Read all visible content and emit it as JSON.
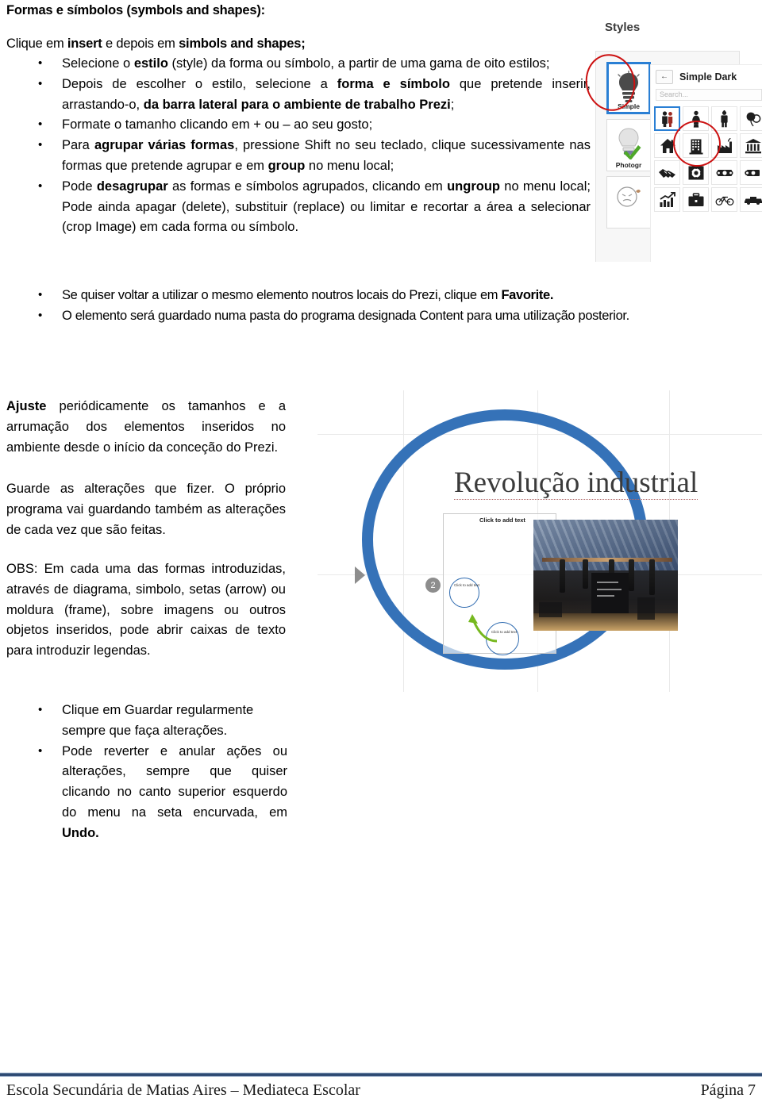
{
  "document": {
    "title": "Formas  e símbolos (symbols and shapes):",
    "lead_prefix": "Clique em ",
    "lead_bold1": "insert",
    "lead_mid": " e depois em ",
    "lead_bold2": "simbols and shapes;"
  },
  "bullets_top": [
    {
      "parts": [
        {
          "t": "Selecione o ",
          "b": false
        },
        {
          "t": "estilo",
          "b": true
        },
        {
          "t": " (style) da forma ou símbolo, a partir de uma gama de oito estilos;",
          "b": false
        }
      ]
    },
    {
      "parts": [
        {
          "t": "Depois de escolher o estilo, selecione a ",
          "b": false
        },
        {
          "t": "forma e símbolo",
          "b": true
        },
        {
          "t": " que pretende inserir, arrastando-o, ",
          "b": false
        },
        {
          "t": "da barra lateral para o ambiente de trabalho Prezi",
          "b": true
        },
        {
          "t": ";",
          "b": false
        }
      ]
    },
    {
      "parts": [
        {
          "t": "Formate o tamanho clicando em + ou – ao seu gosto;",
          "b": false
        }
      ]
    },
    {
      "parts": [
        {
          "t": "Para ",
          "b": false
        },
        {
          "t": "agrupar várias formas",
          "b": true
        },
        {
          "t": ", pressione Shift no seu teclado, clique sucessivamente nas formas que pretende agrupar e em ",
          "b": false
        },
        {
          "t": "group",
          "b": true
        },
        {
          "t": " no menu local;",
          "b": false
        }
      ]
    },
    {
      "parts": [
        {
          "t": "Pode ",
          "b": false
        },
        {
          "t": "desagrupar",
          "b": true
        },
        {
          "t": " as formas e símbolos agrupados, clicando em ",
          "b": false
        },
        {
          "t": "ungroup",
          "b": true
        },
        {
          "t": " no menu local; Pode ainda apagar (delete), substituir (replace) ou limitar e recortar a área a selecionar (crop Image) em cada forma ou símbolo.",
          "b": false
        }
      ]
    }
  ],
  "bullets_wide": [
    {
      "parts": [
        {
          "t": "Se quiser voltar a utilizar o mesmo elemento noutros locais do Prezi, clique em ",
          "b": false
        },
        {
          "t": "Favorite.",
          "b": true
        }
      ]
    },
    {
      "parts": [
        {
          "t": "O elemento será guardado numa pasta do programa designada Content para uma utilização posterior.",
          "b": false
        }
      ]
    }
  ],
  "paragraphs": {
    "ajuste_bold": "Ajuste",
    "ajuste_rest": " periódicamente os tamanhos e a arrumação dos elementos inseridos no ambiente desde o início da conceção do Prezi.",
    "guarde": "Guarde as alterações que fizer. O próprio programa vai guardando também as alterações de cada vez que são feitas.",
    "obs": "OBS: Em cada uma das formas introduzidas, através de diagrama, simbolo, setas (arrow) ou moldura (frame), sobre imagens ou outros objetos inseridos, pode abrir caixas de texto para introduzir legendas."
  },
  "bullets_bottom": [
    {
      "parts": [
        {
          "t": "Clique em Guardar regularmente sempre que faça alterações.",
          "b": false
        }
      ]
    },
    {
      "parts": [
        {
          "t": "Pode reverter e anular ações ou alterações, sempre que quiser clicando no canto superior esquerdo do menu na seta encurvada, em ",
          "b": false
        },
        {
          "t": "Undo.",
          "b": true
        }
      ]
    }
  ],
  "styles_shot": {
    "heading": "Styles",
    "cards": [
      {
        "label": "Simple",
        "selected": true
      },
      {
        "label": "Photogr",
        "selected": false
      },
      {
        "label": "",
        "selected": false
      }
    ],
    "subpanel": {
      "back_label": "←",
      "title": "Simple Dark",
      "search_placeholder": "Search...",
      "icons": [
        {
          "name": "person-pair-icon",
          "selected": true
        },
        {
          "name": "woman-icon",
          "selected": false
        },
        {
          "name": "man-icon",
          "selected": false
        },
        {
          "name": "balloons-icon",
          "selected": false
        },
        {
          "name": "house-icon",
          "selected": false
        },
        {
          "name": "office-building-icon",
          "selected": false
        },
        {
          "name": "factory-icon",
          "selected": false
        },
        {
          "name": "bank-icon",
          "selected": false
        },
        {
          "name": "handshake-icon",
          "selected": false
        },
        {
          "name": "safe-icon",
          "selected": false
        },
        {
          "name": "money-stack-icon",
          "selected": false
        },
        {
          "name": "money-roll-icon",
          "selected": false
        },
        {
          "name": "growth-chart-icon",
          "selected": false
        },
        {
          "name": "briefcase-icon",
          "selected": false
        },
        {
          "name": "bicycle-icon",
          "selected": false
        },
        {
          "name": "car-icon",
          "selected": false
        }
      ]
    },
    "annotations": [
      {
        "name": "red-circle-simple-style"
      },
      {
        "name": "red-circle-woman-symbol"
      }
    ],
    "accent_blue": "#2a7fd4",
    "annotation_red": "#cc1111"
  },
  "prezi_shot": {
    "title": "Revolução industrial",
    "placeholder_text": "Click to add text",
    "step_number": "2",
    "mini_circle_a_label": "Click to add text",
    "mini_circle_b_label": "Click to add text",
    "ring_color": "#3572b8"
  },
  "footer": {
    "left": "Escola Secundária de Matias Aires – Mediateca Escolar",
    "right": "Página 7",
    "rule_color": "#2e4a72"
  }
}
